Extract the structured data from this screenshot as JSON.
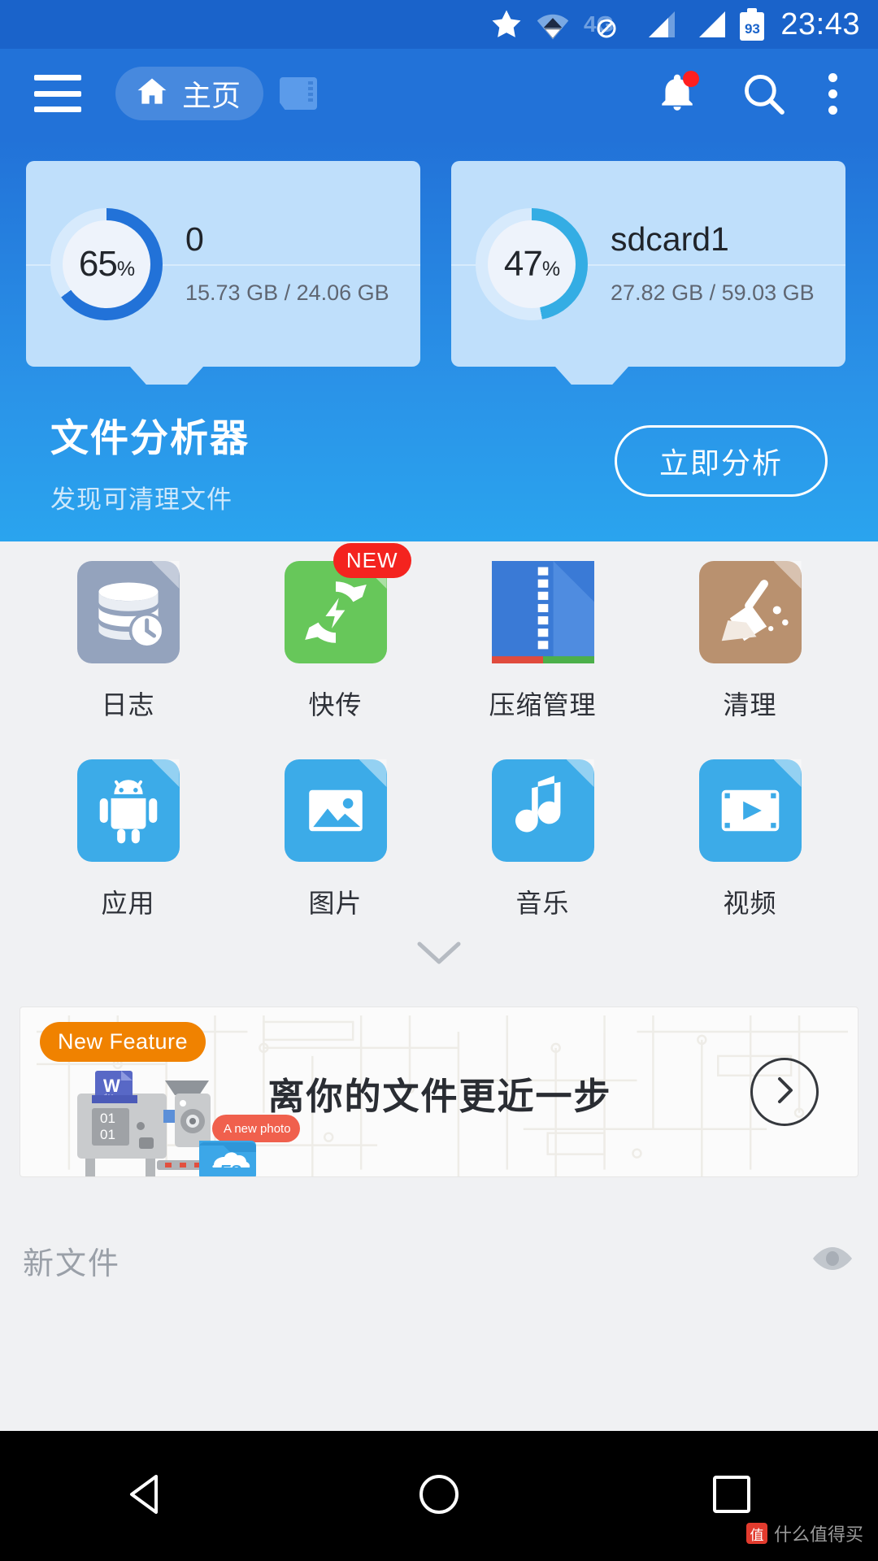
{
  "status_bar": {
    "icons": [
      "star-icon",
      "wifi-icon",
      "4g-disabled-icon",
      "signal-icon-1",
      "signal-icon-2"
    ],
    "network_label": "4G",
    "battery_level": "93",
    "time": "23:43"
  },
  "app_bar": {
    "menu_icon": "hamburger-menu-icon",
    "home_tab_label": "主页",
    "home_icon": "home-icon",
    "sdcard_icon": "sdcard-icon",
    "notification_icon": "bell-icon",
    "search_icon": "search-icon",
    "overflow_icon": "more-vertical-icon"
  },
  "storage_cards": [
    {
      "name": "0",
      "percent": "65",
      "percent_symbol": "%",
      "used": "15.73 GB",
      "total": "24.06 GB",
      "size_text": "15.73 GB / 24.06 GB",
      "arc_color": "#2272d8",
      "track_color": "#bfdffb"
    },
    {
      "name": "sdcard1",
      "percent": "47",
      "percent_symbol": "%",
      "used": "27.82 GB",
      "total": "59.03 GB",
      "size_text": "27.82 GB / 59.03 GB",
      "arc_color": "#34ade4",
      "track_color": "#bfdffb"
    }
  ],
  "analyzer": {
    "title": "文件分析器",
    "subtitle": "发现可清理文件",
    "button_label": "立即分析"
  },
  "grid": {
    "rows": [
      [
        {
          "label": "日志",
          "icon": "log-history-icon",
          "badge": ""
        },
        {
          "label": "快传",
          "icon": "fast-transfer-icon",
          "badge": "NEW"
        },
        {
          "label": "压缩管理",
          "icon": "zip-manager-icon",
          "badge": ""
        },
        {
          "label": "清理",
          "icon": "cleaner-broom-icon",
          "badge": ""
        }
      ],
      [
        {
          "label": "应用",
          "icon": "apps-android-icon",
          "badge": ""
        },
        {
          "label": "图片",
          "icon": "pictures-icon",
          "badge": ""
        },
        {
          "label": "音乐",
          "icon": "music-note-icon",
          "badge": ""
        },
        {
          "label": "视频",
          "icon": "video-play-icon",
          "badge": ""
        }
      ]
    ],
    "expand_icon": "chevron-down-icon"
  },
  "banner": {
    "badge": "New Feature",
    "title": "离你的文件更近一步",
    "photo_bubble": "A new photo",
    "doc_letter": "W",
    "doc_sub": "doc",
    "binary_1": "01",
    "binary_2": "01",
    "next_icon": "chevron-right-icon"
  },
  "new_files": {
    "label": "新文件",
    "eye_icon": "eye-icon"
  },
  "nav_bar": {
    "back_icon": "triangle-back-icon",
    "home_icon": "circle-home-icon",
    "recents_icon": "square-recents-icon"
  },
  "watermark": {
    "mark": "值",
    "text": "什么值得买"
  },
  "colors": {
    "status_bar": "#1a63ca",
    "app_bar": "#2272d8",
    "hero_bottom": "#2aa4ee",
    "page_bg": "#f0f1f3",
    "badge_red": "#f4231f",
    "badge_orange": "#f08200"
  }
}
